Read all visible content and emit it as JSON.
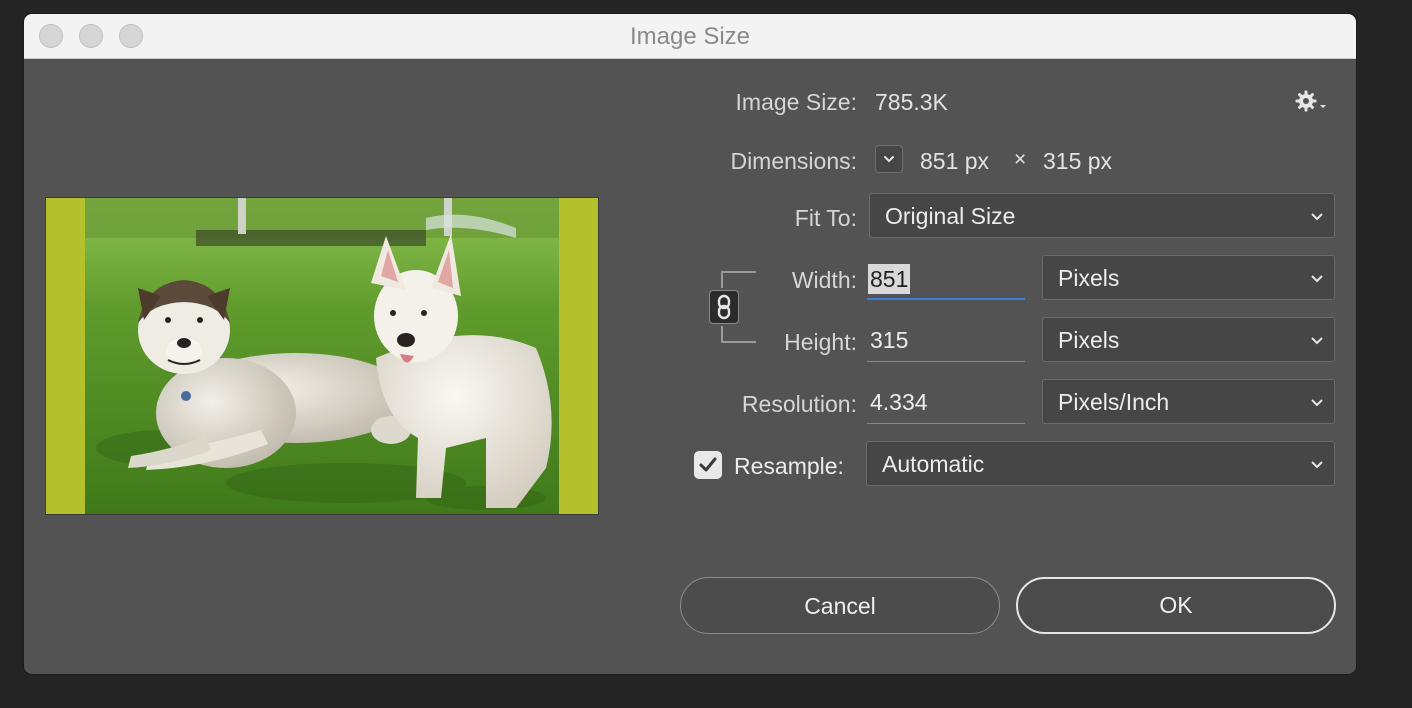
{
  "window": {
    "title": "Image Size"
  },
  "info": {
    "image_size_label": "Image Size:",
    "image_size_value": "785.3K",
    "dimensions_label": "Dimensions:",
    "width_value": "851 px",
    "times_sign": "×",
    "height_value": "315 px"
  },
  "fit_to": {
    "label": "Fit To:",
    "value": "Original Size"
  },
  "width": {
    "label": "Width:",
    "value": "851",
    "unit": "Pixels"
  },
  "height": {
    "label": "Height:",
    "value": "315",
    "unit": "Pixels"
  },
  "resolution": {
    "label": "Resolution:",
    "value": "4.334",
    "unit": "Pixels/Inch"
  },
  "resample": {
    "label": "Resample:",
    "checked": true,
    "value": "Automatic"
  },
  "buttons": {
    "cancel": "Cancel",
    "ok": "OK"
  },
  "icons": {
    "settings": "gear-icon",
    "link": "chain-link-icon",
    "chevron": "chevron-down-icon"
  },
  "colors": {
    "dialog_bg": "#535353",
    "accent": "#3b7ddd",
    "preview_border": "#b4c02c"
  }
}
